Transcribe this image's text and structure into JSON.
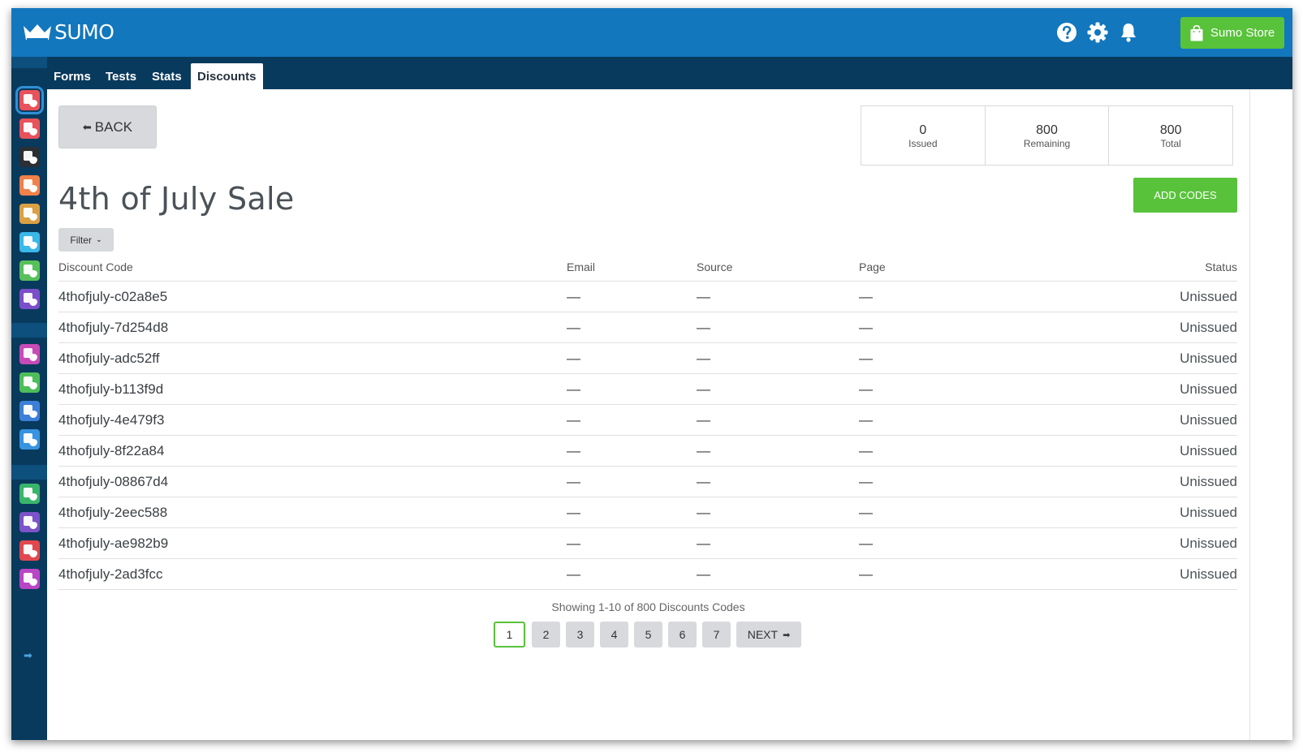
{
  "app": {
    "name": "SUMO"
  },
  "topbar": {
    "store_label": "Sumo Store",
    "icons": [
      "help-icon",
      "gear-icon",
      "bell-icon",
      "shopping-bag-icon"
    ]
  },
  "nav": {
    "tabs": [
      {
        "label": "Forms",
        "active": false
      },
      {
        "label": "Tests",
        "active": false
      },
      {
        "label": "Stats",
        "active": false
      },
      {
        "label": "Discounts",
        "active": true
      }
    ]
  },
  "sidebar": {
    "apps": [
      {
        "color": "#e8525c"
      },
      {
        "color": "#e8525c"
      },
      {
        "color": "#2b2f33"
      },
      {
        "color": "#f0814a"
      },
      {
        "color": "#d9a144"
      },
      {
        "color": "#3ab8e8"
      },
      {
        "color": "#57c05a"
      },
      {
        "color": "#7b4fc9"
      },
      {
        "color": "#c74bb7"
      },
      {
        "color": "#4dbd5a"
      },
      {
        "color": "#3c7fd8"
      },
      {
        "color": "#3893e0"
      },
      {
        "color": "#39b56b"
      },
      {
        "color": "#7c53c8"
      },
      {
        "color": "#e0484e"
      },
      {
        "color": "#b946c4"
      }
    ]
  },
  "back_label": "BACK",
  "stats": [
    {
      "value": "0",
      "label": "Issued"
    },
    {
      "value": "800",
      "label": "Remaining"
    },
    {
      "value": "800",
      "label": "Total"
    }
  ],
  "page_title": "4th of July Sale",
  "add_codes_label": "ADD CODES",
  "filter_label": "Filter",
  "table": {
    "headers": {
      "code": "Discount Code",
      "email": "Email",
      "source": "Source",
      "page": "Page",
      "status": "Status"
    },
    "rows": [
      {
        "code": "4thofjuly-c02a8e5",
        "email": "—",
        "source": "—",
        "page": "—",
        "status": "Unissued"
      },
      {
        "code": "4thofjuly-7d254d8",
        "email": "—",
        "source": "—",
        "page": "—",
        "status": "Unissued"
      },
      {
        "code": "4thofjuly-adc52ff",
        "email": "—",
        "source": "—",
        "page": "—",
        "status": "Unissued"
      },
      {
        "code": "4thofjuly-b113f9d",
        "email": "—",
        "source": "—",
        "page": "—",
        "status": "Unissued"
      },
      {
        "code": "4thofjuly-4e479f3",
        "email": "—",
        "source": "—",
        "page": "—",
        "status": "Unissued"
      },
      {
        "code": "4thofjuly-8f22a84",
        "email": "—",
        "source": "—",
        "page": "—",
        "status": "Unissued"
      },
      {
        "code": "4thofjuly-08867d4",
        "email": "—",
        "source": "—",
        "page": "—",
        "status": "Unissued"
      },
      {
        "code": "4thofjuly-2eec588",
        "email": "—",
        "source": "—",
        "page": "—",
        "status": "Unissued"
      },
      {
        "code": "4thofjuly-ae982b9",
        "email": "—",
        "source": "—",
        "page": "—",
        "status": "Unissued"
      },
      {
        "code": "4thofjuly-2ad3fcc",
        "email": "—",
        "source": "—",
        "page": "—",
        "status": "Unissued"
      }
    ]
  },
  "pagination": {
    "info": "Showing 1-10 of 800 Discounts Codes",
    "pages": [
      "1",
      "2",
      "3",
      "4",
      "5",
      "6",
      "7"
    ],
    "current": "1",
    "next_label": "NEXT"
  },
  "colors": {
    "brand_blue": "#1277bd",
    "nav_dark": "#083a5d",
    "green": "#59c23b"
  }
}
